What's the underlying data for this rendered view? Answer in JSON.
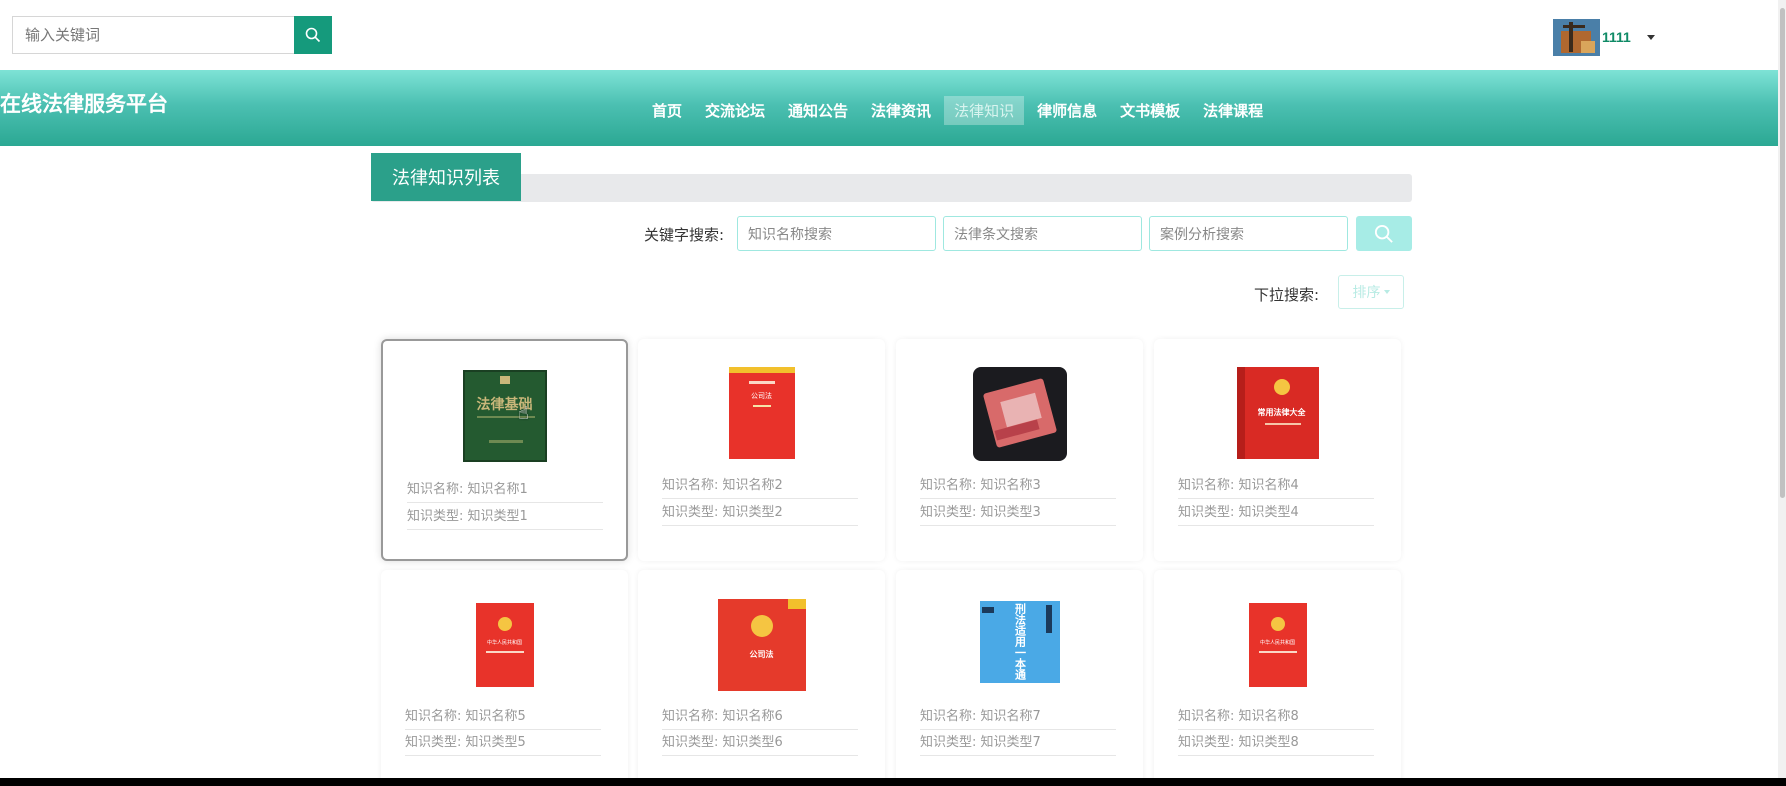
{
  "topbar": {
    "search_placeholder": "输入关键词",
    "username": "1111"
  },
  "header": {
    "brand": "在线法律服务平台",
    "nav": [
      "首页",
      "交流论坛",
      "通知公告",
      "法律资讯",
      "法律知识",
      "律师信息",
      "文书模板",
      "法律课程"
    ],
    "active_nav": "法律知识"
  },
  "section": {
    "title": "法律知识列表",
    "keyword_label": "关键字搜索:",
    "placeholders": [
      "知识名称搜索",
      "法律条文搜索",
      "案例分析搜索"
    ],
    "dropdown_label": "下拉搜索:",
    "sort_label": "排序"
  },
  "cards": [
    {
      "name_label": "知识名称:",
      "name": "知识名称1",
      "type_label": "知识类型:",
      "type": "知识类型1",
      "cover_title": "法律基础"
    },
    {
      "name_label": "知识名称:",
      "name": "知识名称2",
      "type_label": "知识类型:",
      "type": "知识类型2",
      "cover_title": "公司法"
    },
    {
      "name_label": "知识名称:",
      "name": "知识名称3",
      "type_label": "知识类型:",
      "type": "知识类型3",
      "cover_title": ""
    },
    {
      "name_label": "知识名称:",
      "name": "知识名称4",
      "type_label": "知识类型:",
      "type": "知识类型4",
      "cover_title": "常用法律大全"
    },
    {
      "name_label": "知识名称:",
      "name": "知识名称5",
      "type_label": "知识类型:",
      "type": "知识类型5",
      "cover_title": "中华人民共和国"
    },
    {
      "name_label": "知识名称:",
      "name": "知识名称6",
      "type_label": "知识类型:",
      "type": "知识类型6",
      "cover_title": "公司法"
    },
    {
      "name_label": "知识名称:",
      "name": "知识名称7",
      "type_label": "知识类型:",
      "type": "知识类型7",
      "cover_title": "刑法适用一本通"
    },
    {
      "name_label": "知识名称:",
      "name": "知识名称8",
      "type_label": "知识类型:",
      "type": "知识类型8",
      "cover_title": "中华人民共和国"
    }
  ],
  "colors": {
    "accent": "#159a7c",
    "header_top": "#7ee3d6",
    "header_bottom": "#2ba893",
    "tab_bg": "#2ba08a"
  }
}
